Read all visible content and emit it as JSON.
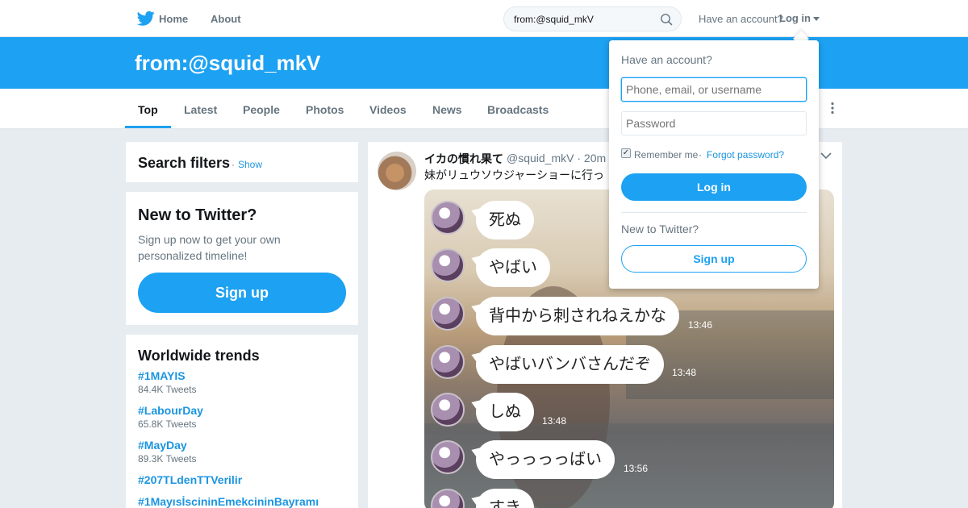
{
  "colors": {
    "brand": "#1da1f2",
    "link": "#1b95e0",
    "background": "#e6ecf0"
  },
  "nav": {
    "logo_icon": "twitter-bird-icon",
    "home_label": "Home",
    "about_label": "About",
    "search_value": "from:@squid_mkV",
    "have_account": "Have an account?",
    "login_label": "Log in"
  },
  "banner": {
    "title": "from:@squid_mkV"
  },
  "tabs": [
    {
      "label": "Top"
    },
    {
      "label": "Latest"
    },
    {
      "label": "People"
    },
    {
      "label": "Photos"
    },
    {
      "label": "Videos"
    },
    {
      "label": "News"
    },
    {
      "label": "Broadcasts"
    }
  ],
  "active_tab": "Top",
  "filters": {
    "title": "Search filters",
    "separator": "·",
    "show_label": "Show"
  },
  "new_to_twitter": {
    "title": "New to Twitter?",
    "description": "Sign up now to get your own personalized timeline!",
    "signup_label": "Sign up"
  },
  "trends": {
    "title": "Worldwide trends",
    "items": [
      {
        "name": "#1MAYIS",
        "count": "84.4K Tweets"
      },
      {
        "name": "#LabourDay",
        "count": "65.8K Tweets"
      },
      {
        "name": "#MayDay",
        "count": "89.3K Tweets"
      },
      {
        "name": "#207TLdenTTVerilir",
        "count": ""
      },
      {
        "name": "#1MayısİscininEmekcininBayramı",
        "count": ""
      }
    ]
  },
  "tweet": {
    "name": "イカの慣れ果て",
    "handle_time": "@squid_mkV · 20m",
    "text": "妹がリュウソウジャーショーに行っ",
    "chat": [
      {
        "text": "死ぬ",
        "time": ""
      },
      {
        "text": "やばい",
        "time": ""
      },
      {
        "text": "背中から刺されねえかな",
        "time": "13:46"
      },
      {
        "text": "やばいバンバさんだぞ",
        "time": "13:48"
      },
      {
        "text": "しぬ",
        "time": "13:48"
      },
      {
        "text": "やっっっっばい",
        "time": "13:56"
      },
      {
        "text": "すき",
        "time": ""
      }
    ]
  },
  "login_dropdown": {
    "title": "Have an account?",
    "username_placeholder": "Phone, email, or username",
    "password_placeholder": "Password",
    "remember_label": "Remember me",
    "separator": "·",
    "forgot_label": "Forgot password?",
    "login_label": "Log in",
    "new_label": "New to Twitter?",
    "signup_label": "Sign up"
  }
}
